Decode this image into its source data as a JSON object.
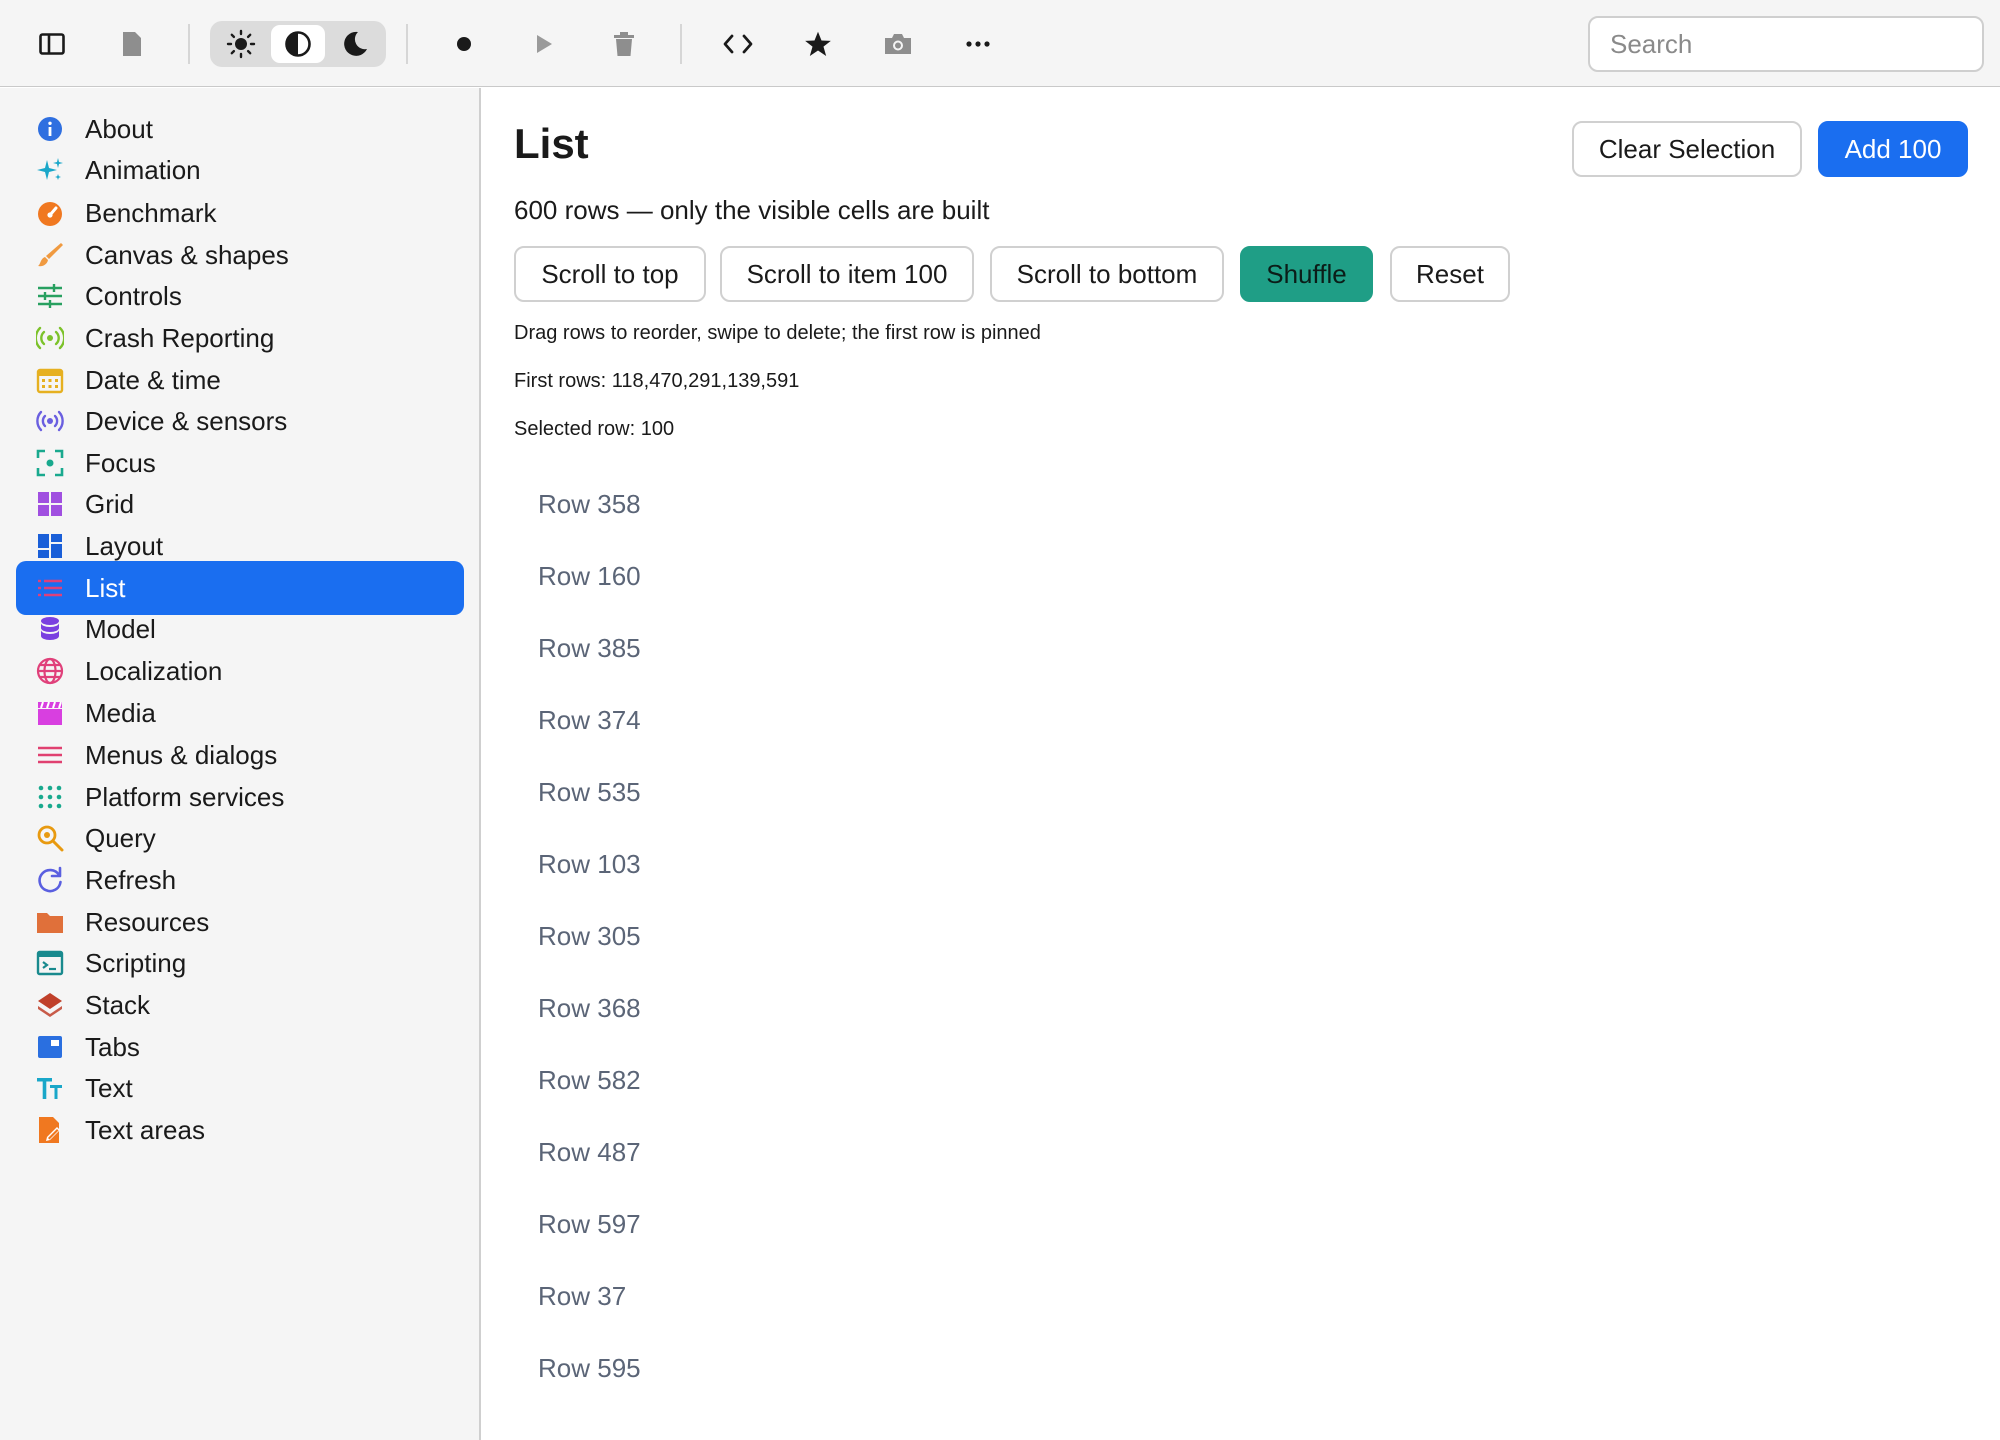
{
  "toolbar": {
    "search_placeholder": "Search",
    "icons": [
      "sidebar-toggle-icon",
      "document-icon",
      "sun-icon",
      "contrast-icon",
      "moon-icon",
      "record-icon",
      "play-icon",
      "trash-icon",
      "code-icon",
      "star-icon",
      "camera-icon",
      "more-icon"
    ],
    "active_theme": "contrast"
  },
  "sidebar": {
    "items": [
      {
        "label": "About",
        "icon": "info-icon",
        "color": "#2f6fe0"
      },
      {
        "label": "Animation",
        "icon": "sparkles-icon",
        "color": "#19a7c9"
      },
      {
        "label": "Benchmark",
        "icon": "speedometer-icon",
        "color": "#f07820"
      },
      {
        "label": "Canvas & shapes",
        "icon": "paintbrush-icon",
        "color": "#f09a40"
      },
      {
        "label": "Controls",
        "icon": "sliders-icon",
        "color": "#28a060"
      },
      {
        "label": "Crash Reporting",
        "icon": "broadcast-icon",
        "color": "#7cc22a"
      },
      {
        "label": "Date & time",
        "icon": "calendar-icon",
        "color": "#e6b020"
      },
      {
        "label": "Device & sensors",
        "icon": "sensor-icon",
        "color": "#6a5fe0"
      },
      {
        "label": "Focus",
        "icon": "focus-icon",
        "color": "#19a98e"
      },
      {
        "label": "Grid",
        "icon": "grid-icon",
        "color": "#a04fe0"
      },
      {
        "label": "Layout",
        "icon": "layout-icon",
        "color": "#1a5fd8"
      },
      {
        "label": "List",
        "icon": "list-icon",
        "color": "#e0407a"
      },
      {
        "label": "Model",
        "icon": "database-icon",
        "color": "#7a3fe0"
      },
      {
        "label": "Localization",
        "icon": "globe-icon",
        "color": "#e0407a"
      },
      {
        "label": "Media",
        "icon": "clapperboard-icon",
        "color": "#d83fe0"
      },
      {
        "label": "Menus & dialogs",
        "icon": "menu-icon",
        "color": "#e04070"
      },
      {
        "label": "Platform services",
        "icon": "dots-grid-icon",
        "color": "#19a98e"
      },
      {
        "label": "Query",
        "icon": "magnifier-icon",
        "color": "#e89a10"
      },
      {
        "label": "Refresh",
        "icon": "refresh-icon",
        "color": "#5a5fe0"
      },
      {
        "label": "Resources",
        "icon": "folder-icon",
        "color": "#e0703a"
      },
      {
        "label": "Scripting",
        "icon": "terminal-icon",
        "color": "#198a8e"
      },
      {
        "label": "Stack",
        "icon": "stack-icon",
        "color": "#c0402a"
      },
      {
        "label": "Tabs",
        "icon": "tabs-icon",
        "color": "#2a6fe0"
      },
      {
        "label": "Text",
        "icon": "text-icon",
        "color": "#19a7c9"
      },
      {
        "label": "Text areas",
        "icon": "text-area-icon",
        "color": "#f07820"
      }
    ],
    "active_index": 11
  },
  "main": {
    "title": "List",
    "clear_label": "Clear Selection",
    "add_label": "Add 100",
    "subtitle": "600 rows — only the visible cells are built",
    "actions": [
      "Scroll to top",
      "Scroll to item 100",
      "Scroll to bottom",
      "Shuffle",
      "Reset"
    ],
    "hint": "Drag rows to reorder, swipe to delete; the first row is pinned",
    "first_rows": "First rows: 118,470,291,139,591",
    "selected": "Selected row: 100",
    "rows": [
      "Row 358",
      "Row 160",
      "Row 385",
      "Row 374",
      "Row 535",
      "Row 103",
      "Row 305",
      "Row 368",
      "Row 582",
      "Row 487",
      "Row 597",
      "Row 37",
      "Row 595"
    ]
  }
}
